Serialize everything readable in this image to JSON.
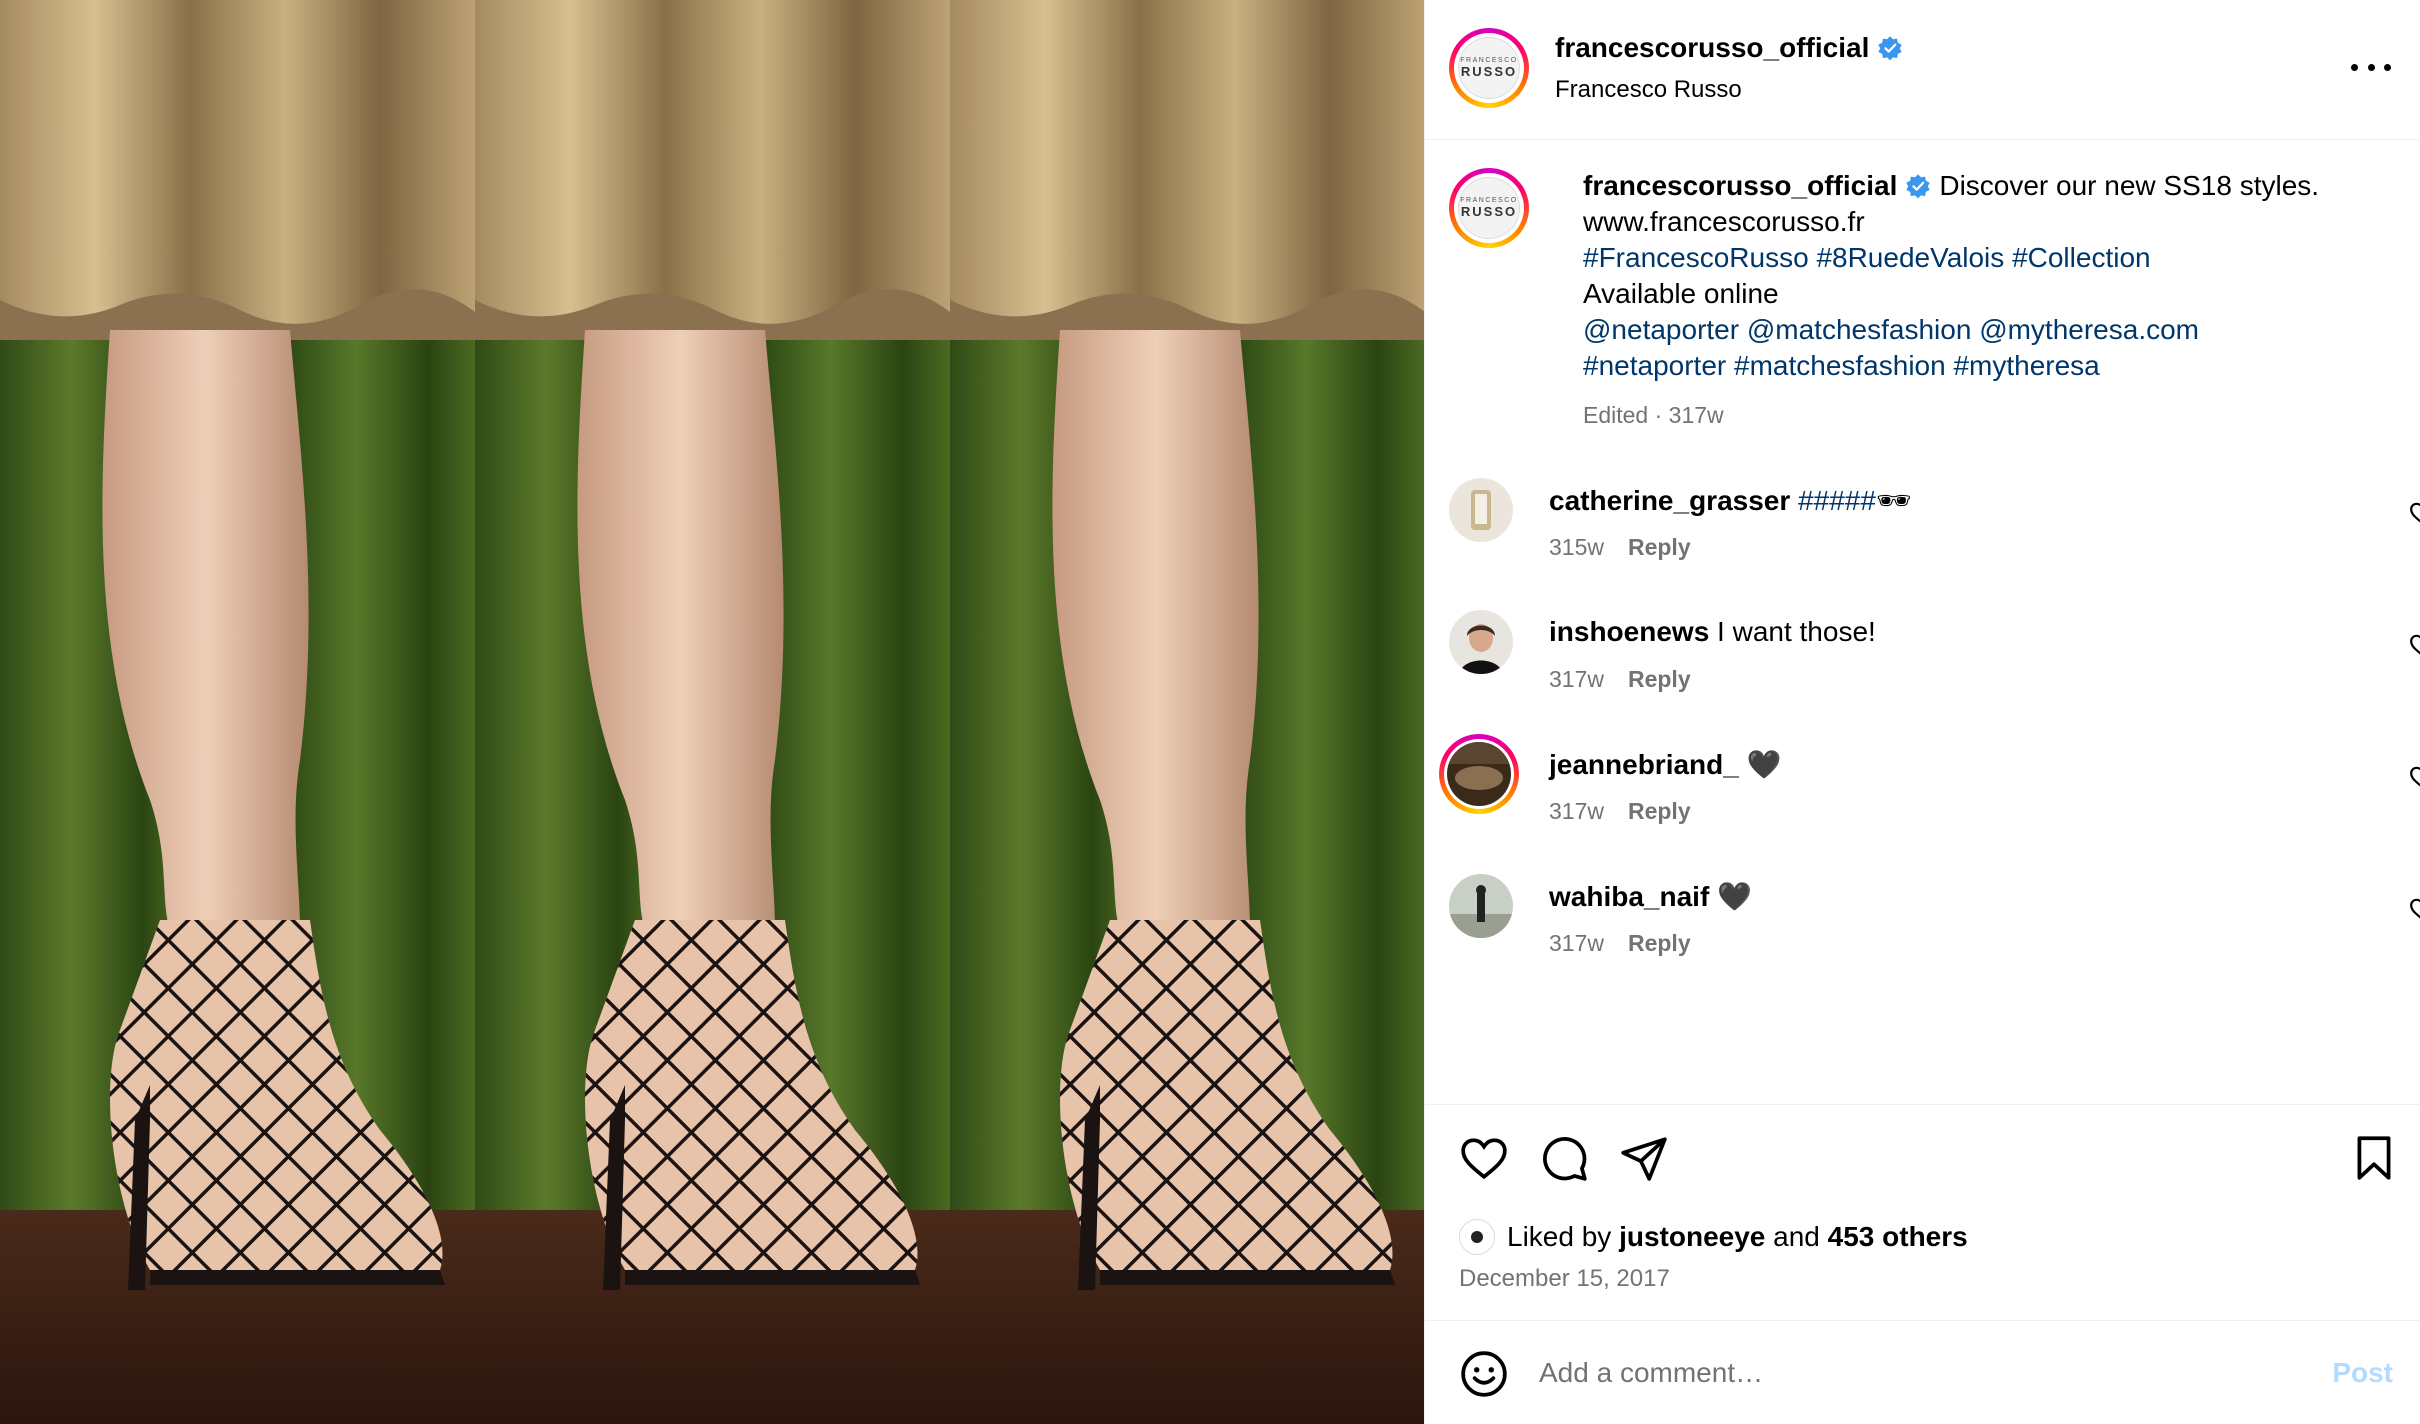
{
  "post": {
    "author": "francescorusso_official",
    "author_subtitle": "Francesco Russo",
    "logo_small": "FRANCESCO",
    "logo_big": "RUSSO",
    "more_icon": "more-horizontal-icon",
    "verified_icon": "verified-badge-icon",
    "caption": {
      "text": "Discover our new SS18 styles.",
      "url": "www.francescorusso.fr",
      "hashtags1": [
        "#FrancescoRusso",
        "#8RuedeValois",
        "#Collection"
      ],
      "available": "Available online",
      "mentions": [
        "@netaporter",
        "@matchesfashion",
        "@mytheresa.com"
      ],
      "hashtags2": [
        "#netaporter",
        "#matchesfashion",
        "#mytheresa"
      ],
      "edited": "Edited",
      "sep": "·",
      "age": "317w"
    },
    "comments": [
      {
        "user": "catherine_grasser",
        "text": "#####",
        "emoji": "🕶",
        "age": "315w",
        "reply": "Reply"
      },
      {
        "user": "inshoenews",
        "text": "I want those!",
        "emoji": "",
        "age": "317w",
        "reply": "Reply"
      },
      {
        "user": "jeannebriand_",
        "text": "",
        "emoji": "🖤",
        "age": "317w",
        "reply": "Reply"
      },
      {
        "user": "wahiba_naif",
        "text": "",
        "emoji": "🖤",
        "age": "317w",
        "reply": "Reply"
      }
    ],
    "likes": {
      "prefix": "Liked by",
      "user": "justoneeye",
      "and": "and",
      "others": "453 others"
    },
    "date": "December 15, 2017",
    "composer": {
      "placeholder": "Add a comment…",
      "post_label": "Post"
    }
  },
  "colors": {
    "link": "#00376b",
    "verified": "#3897f0",
    "muted": "#737373",
    "post_disabled": "#b3dbff"
  }
}
